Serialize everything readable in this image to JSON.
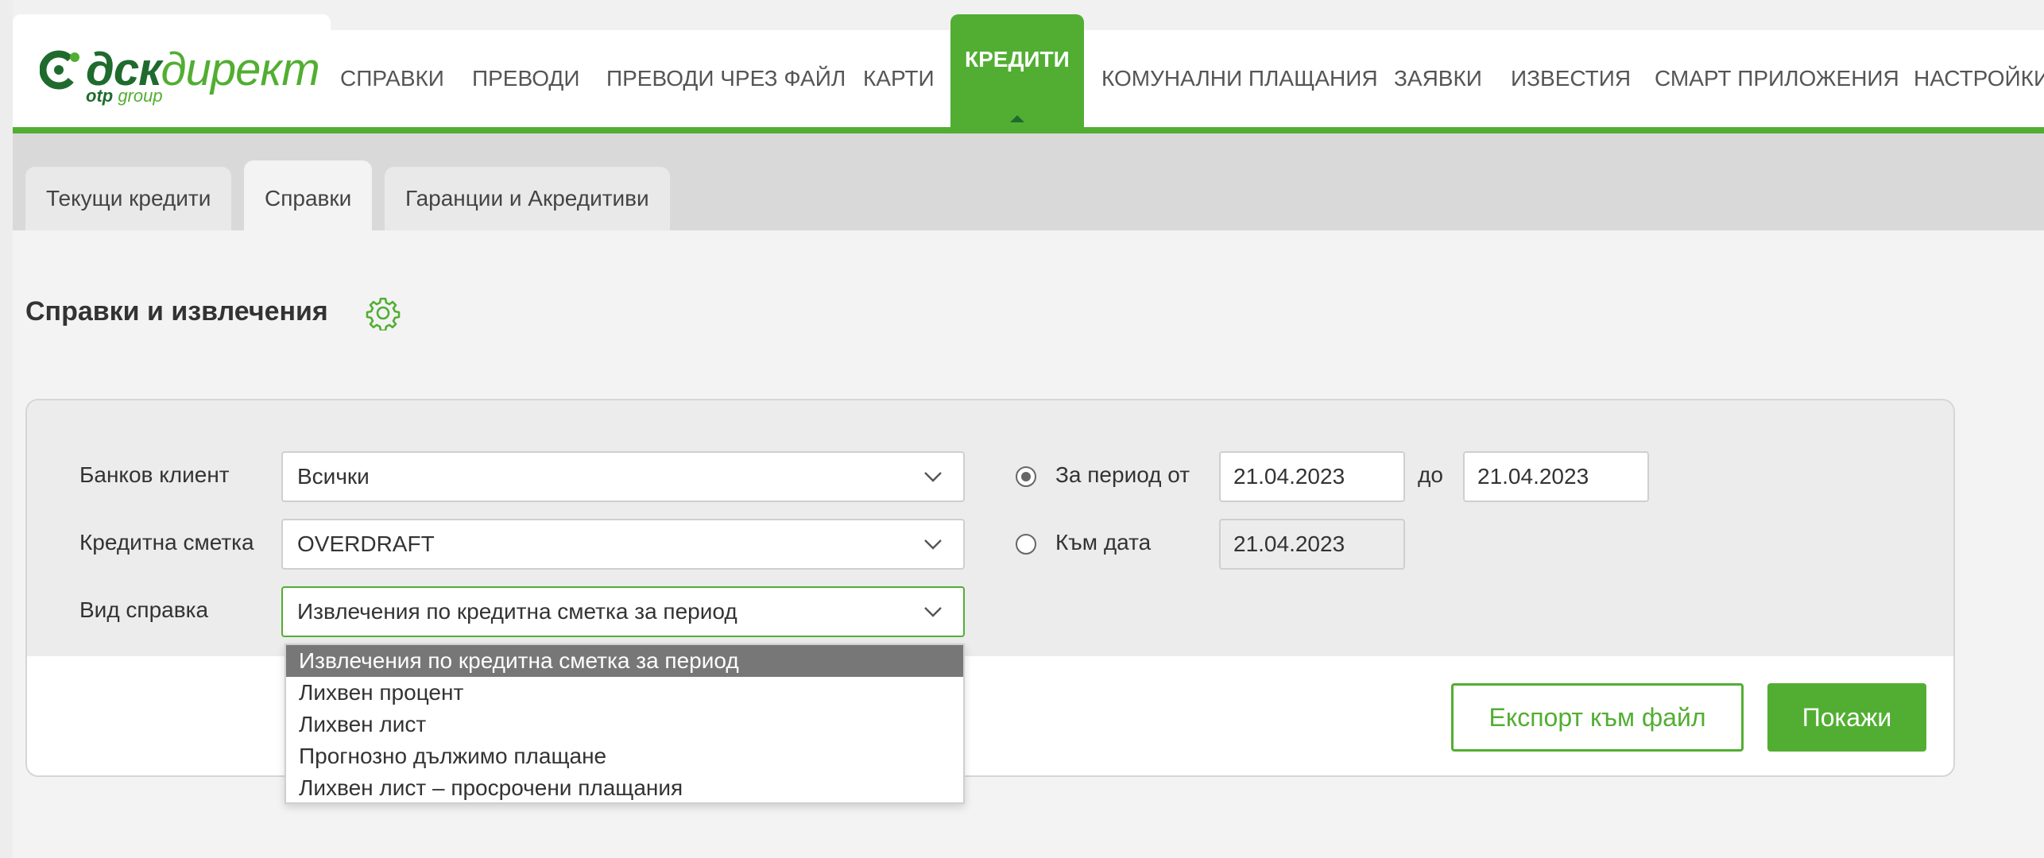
{
  "brand": {
    "name_part1": "дск",
    "name_part2": "директ",
    "sub_bold": "otp",
    "sub_rest": " group",
    "accent_color": "#52ae32",
    "dark_color": "#1f6b2e"
  },
  "nav": {
    "items": [
      {
        "label": "СПРАВКИ"
      },
      {
        "label": "ПРЕВОДИ"
      },
      {
        "label": "ПРЕВОДИ ЧРЕЗ ФАЙЛ"
      },
      {
        "label": "КАРТИ"
      },
      {
        "label": "КРЕДИТИ",
        "active": true
      },
      {
        "label": "КОМУНАЛНИ ПЛАЩАНИЯ"
      },
      {
        "label": "ЗАЯВКИ"
      },
      {
        "label": "ИЗВЕСТИЯ"
      },
      {
        "label": "СМАРТ ПРИЛОЖЕНИЯ"
      },
      {
        "label": "НАСТРОЙКИ"
      }
    ]
  },
  "subtabs": [
    {
      "label": "Текущи кредити"
    },
    {
      "label": "Справки",
      "active": true
    },
    {
      "label": "Гаранции и Акредитиви"
    }
  ],
  "page": {
    "title": "Справки и извлечения",
    "settings_icon": "gear-icon"
  },
  "form": {
    "client_label": "Банков клиент",
    "client_value": "Всички",
    "account_label": "Кредитна сметка",
    "account_value": "OVERDRAFT",
    "report_type_label": "Вид справка",
    "report_type_value": "Извлечения по кредитна сметка за период",
    "period_radio_label": "За период от",
    "period_from": "21.04.2023",
    "period_to_label": "до",
    "period_to": "21.04.2023",
    "as_of_radio_label": "Към дата",
    "as_of_date": "21.04.2023",
    "selected_radio": "period"
  },
  "dropdown": {
    "options": [
      {
        "label": "Извлечения по кредитна сметка за период",
        "selected": true
      },
      {
        "label": "Лихвен процент"
      },
      {
        "label": "Лихвен лист"
      },
      {
        "label": "Прогнозно дължимо плащане"
      },
      {
        "label": "Лихвен лист – просрочени плащания"
      }
    ]
  },
  "actions": {
    "export_label": "Експорт към файл",
    "show_label": "Покажи"
  }
}
